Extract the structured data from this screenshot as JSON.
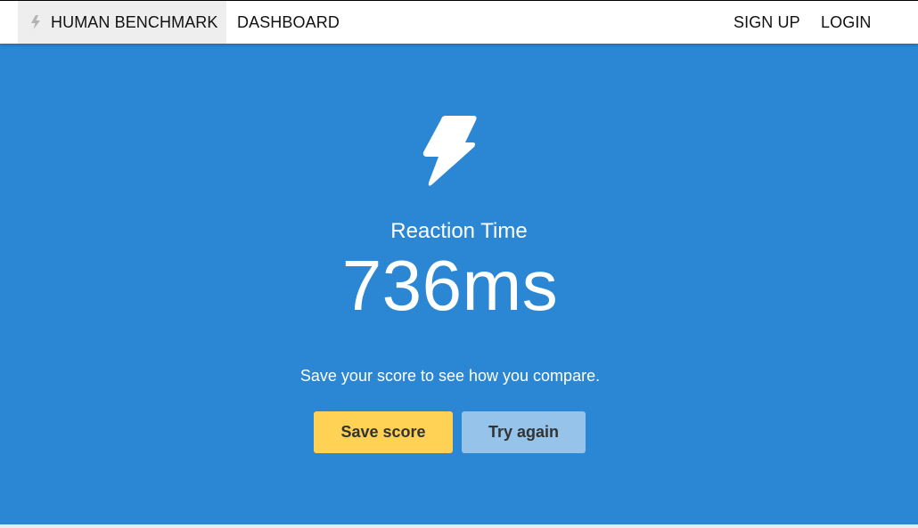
{
  "nav": {
    "brand": "HUMAN BENCHMARK",
    "dashboard": "DASHBOARD",
    "sign_up": "SIGN UP",
    "login": "LOGIN"
  },
  "result": {
    "icon": "lightning-bolt-icon",
    "title": "Reaction Time",
    "score": "736ms",
    "hint": "Save your score to see how you compare."
  },
  "actions": {
    "save_label": "Save score",
    "try_again_label": "Try again"
  },
  "colors": {
    "hero_background": "#2b87d3",
    "save_button": "#ffd154",
    "try_again_button": "#95c3e9",
    "nav_background": "#ffffff"
  }
}
